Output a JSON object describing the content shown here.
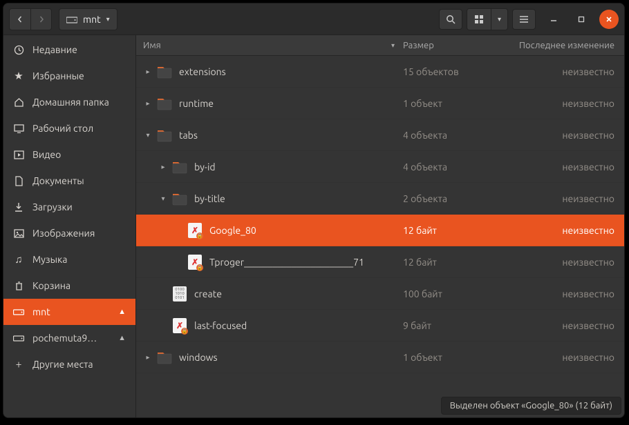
{
  "path": {
    "label": "mnt"
  },
  "columns": {
    "name": "Имя",
    "size": "Размер",
    "modified": "Последнее изменение"
  },
  "sidebar": {
    "items": [
      {
        "icon": "clock",
        "label": "Недавние"
      },
      {
        "icon": "star",
        "label": "Избранные"
      },
      {
        "icon": "home",
        "label": "Домашняя папка"
      },
      {
        "icon": "desktop",
        "label": "Рабочий стол"
      },
      {
        "icon": "video",
        "label": "Видео"
      },
      {
        "icon": "doc",
        "label": "Документы"
      },
      {
        "icon": "download",
        "label": "Загрузки"
      },
      {
        "icon": "image",
        "label": "Изображения"
      },
      {
        "icon": "music",
        "label": "Музыка"
      },
      {
        "icon": "trash",
        "label": "Корзина"
      },
      {
        "icon": "drive",
        "label": "mnt",
        "active": true,
        "eject": true
      },
      {
        "icon": "drive",
        "label": "pochemuta9…",
        "eject": true
      },
      {
        "icon": "plus",
        "label": "Другие места"
      }
    ]
  },
  "files": [
    {
      "depth": 0,
      "expander": "▸",
      "type": "folder",
      "name": "extensions",
      "size": "15 объектов",
      "modified": "неизвестно"
    },
    {
      "depth": 0,
      "expander": "▸",
      "type": "folder",
      "name": "runtime",
      "size": "1 объект",
      "modified": "неизвестно"
    },
    {
      "depth": 0,
      "expander": "▾",
      "type": "folder",
      "name": "tabs",
      "size": "4 объекта",
      "modified": "неизвестно"
    },
    {
      "depth": 1,
      "expander": "▸",
      "type": "folder",
      "name": "by-id",
      "size": "4 объекта",
      "modified": "неизвестно"
    },
    {
      "depth": 1,
      "expander": "▾",
      "type": "folder",
      "name": "by-title",
      "size": "2 объекта",
      "modified": "неизвестно"
    },
    {
      "depth": 2,
      "expander": "",
      "type": "link",
      "name": "Google_80",
      "size": "12 байт",
      "modified": "неизвестно",
      "selected": true
    },
    {
      "depth": 2,
      "expander": "",
      "type": "link",
      "name": "Tproger_______________________71",
      "size": "12 байт",
      "modified": "неизвестно"
    },
    {
      "depth": 1,
      "expander": "",
      "type": "bin",
      "name": "create",
      "size": "100 байт",
      "modified": "неизвестно"
    },
    {
      "depth": 1,
      "expander": "",
      "type": "link",
      "name": "last-focused",
      "size": "9 байт",
      "modified": "неизвестно"
    },
    {
      "depth": 0,
      "expander": "▸",
      "type": "folder",
      "name": "windows",
      "size": "1 объект",
      "modified": "неизвестно"
    }
  ],
  "statusbar": "Выделен объект «Google_80» (12 байт)"
}
